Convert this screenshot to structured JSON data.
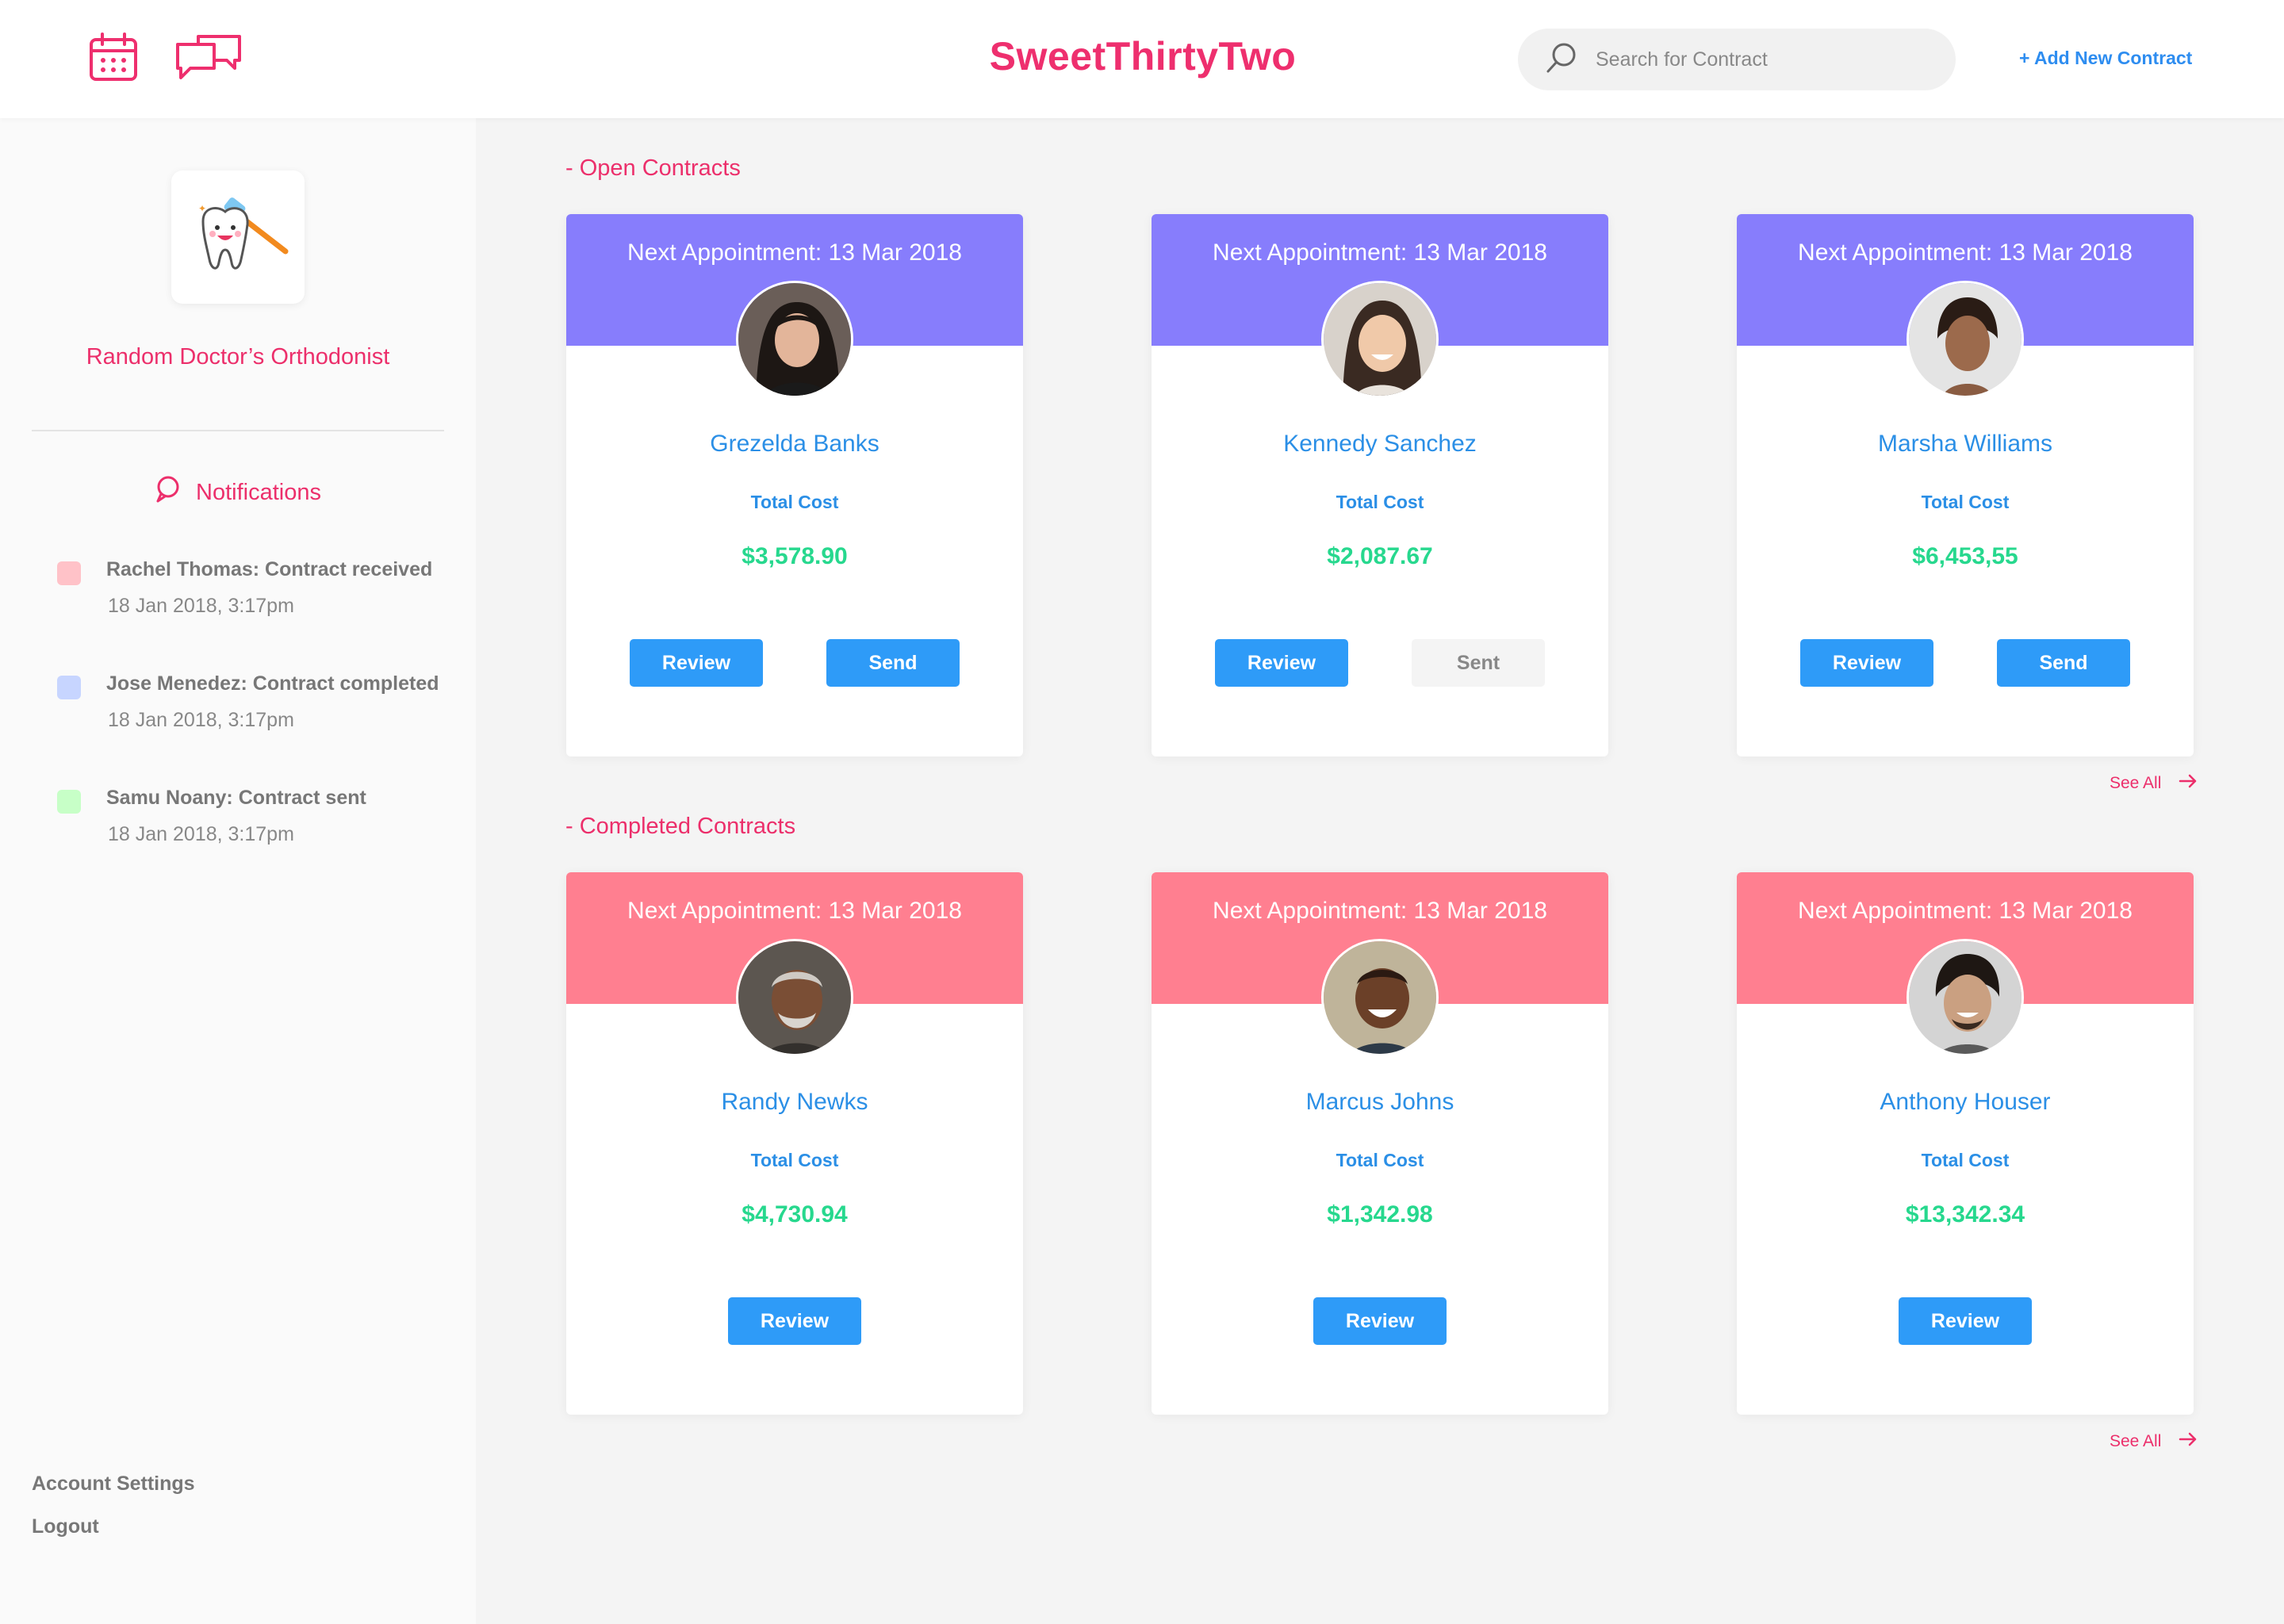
{
  "brand": "SweetThirtyTwo",
  "header": {
    "search_placeholder": "Search for Contract",
    "add_label": "+ Add New Contract"
  },
  "sidebar": {
    "clinic_name": "Random Doctor’s Orthodonist",
    "notifications_title": "Notifications",
    "notifications": [
      {
        "text": "Rachel Thomas: Contract received",
        "time": "18 Jan 2018, 3:17pm",
        "color": "#ffc2c8"
      },
      {
        "text": "Jose Menedez: Contract completed",
        "time": "18 Jan 2018, 3:17pm",
        "color": "#c7d5ff"
      },
      {
        "text": "Samu Noany: Contract sent",
        "time": "18 Jan 2018, 3:17pm",
        "color": "#c7ffc7"
      }
    ],
    "account_settings": "Account Settings",
    "logout": "Logout"
  },
  "open": {
    "title": "- Open Contracts",
    "header_color": "#877dfc",
    "see_all": "See All",
    "cards": [
      {
        "appointment": "Next Appointment: 13 Mar 2018",
        "name": "Grezelda Banks",
        "cost_label": "Total Cost",
        "cost": "$3,578.90",
        "review": "Review",
        "action": "Send"
      },
      {
        "appointment": "Next Appointment: 13 Mar 2018",
        "name": "Kennedy Sanchez",
        "cost_label": "Total Cost",
        "cost": "$2,087.67",
        "review": "Review",
        "action": "Sent"
      },
      {
        "appointment": "Next Appointment: 13 Mar 2018",
        "name": "Marsha Williams",
        "cost_label": "Total Cost",
        "cost": "$6,453,55",
        "review": "Review",
        "action": "Send"
      }
    ]
  },
  "completed": {
    "title": "- Completed Contracts",
    "header_color": "#ff7f90",
    "see_all": "See All",
    "cards": [
      {
        "appointment": "Next Appointment: 13 Mar 2018",
        "name": "Randy Newks",
        "cost_label": "Total Cost",
        "cost": "$4,730.94",
        "review": "Review"
      },
      {
        "appointment": "Next Appointment: 13 Mar 2018",
        "name": "Marcus Johns",
        "cost_label": "Total Cost",
        "cost": "$1,342.98",
        "review": "Review"
      },
      {
        "appointment": "Next Appointment: 13 Mar 2018",
        "name": "Anthony Houser",
        "cost_label": "Total Cost",
        "cost": "$13,342.34",
        "review": "Review"
      }
    ]
  },
  "colors": {
    "brand": "#ee2f6e",
    "link_blue": "#2e8df0",
    "button_blue": "#2e9bf8",
    "cost_green": "#27d88e"
  }
}
